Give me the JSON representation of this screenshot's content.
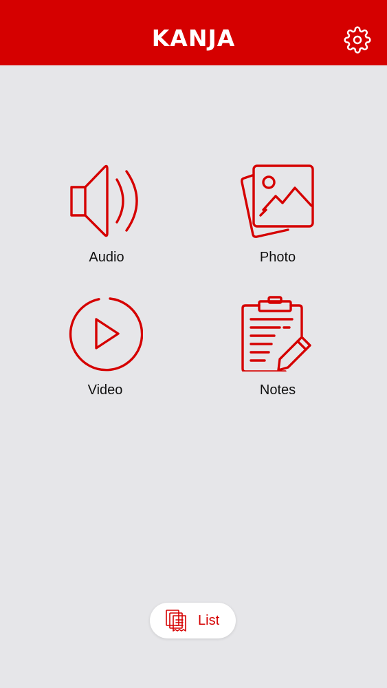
{
  "header": {
    "title": "KANJA",
    "settings_icon": "gear-icon"
  },
  "colors": {
    "accent": "#d50000",
    "background": "#e6e6e9",
    "header_text": "#ffffff"
  },
  "tiles": [
    {
      "label": "Audio",
      "icon": "speaker-icon"
    },
    {
      "label": "Photo",
      "icon": "photo-icon"
    },
    {
      "label": "Video",
      "icon": "play-icon"
    },
    {
      "label": "Notes",
      "icon": "clipboard-pencil-icon"
    }
  ],
  "list_button": {
    "label": "List",
    "icon": "documents-icon"
  }
}
